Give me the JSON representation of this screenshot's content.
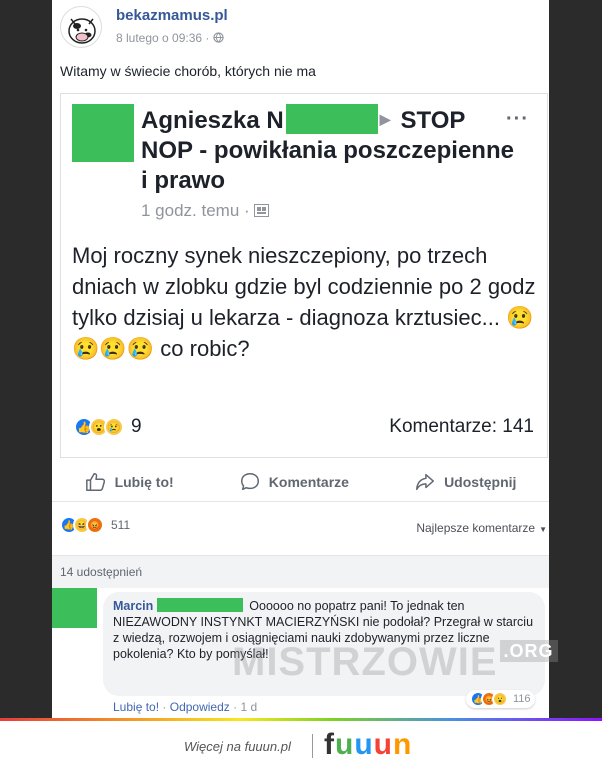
{
  "post": {
    "page_name": "bekazmamus.pl",
    "date": "8 lutego o 09:36",
    "audience_icon": "globe-icon",
    "caption": "Witamy w świecie chorób, których nie ma"
  },
  "shared_post": {
    "author": "Agnieszka N",
    "group_part1": "STOP",
    "group_part2": "NOP - powikłania poszczepienne i prawo",
    "time": "1 godz. temu",
    "text": "Moj roczny synek nieszczepiony, po trzech dniach w zlobku gdzie byl codziennie po 2 godz tylko dzisiaj u lekarza - diagnoza krztusiec... 😢😢😢😢 co robic?",
    "reaction_count": "9",
    "comments_label": "Komentarze: 141"
  },
  "actions": {
    "like": "Lubię to!",
    "comment": "Komentarze",
    "share": "Udostępnij"
  },
  "stats": {
    "reactions_count": "511",
    "sort_label": "Najlepsze komentarze",
    "shares": "14 udostępnień"
  },
  "comment": {
    "author": "Marcin",
    "text": "Oooooo no popatrz pani! To jednak ten NIEZAWODNY INSTYNKT MACIERZYŃSKI nie podołał? Przegrał w starciu z wiedzą, rozwojem i osiągnięciami nauki zdobywanymi przez liczne pokolenia? Kto by pomyślał!",
    "reactions_count": "116",
    "like_link": "Lubię to!",
    "reply_link": "Odpowiedz",
    "age": "1 d"
  },
  "watermark": {
    "text": "MISTRZOWIE",
    "suffix": ".ORG"
  },
  "footer": {
    "more_text": "Więcej na fuuun.pl",
    "logo": "fuuun",
    "logo_colors": [
      "#333333",
      "#4caf50",
      "#2196f3",
      "#f44336",
      "#ff9800"
    ]
  },
  "colors": {
    "link_blue": "#365899",
    "like_blue": "#1877f2",
    "censor_green": "#3cbf5b"
  }
}
